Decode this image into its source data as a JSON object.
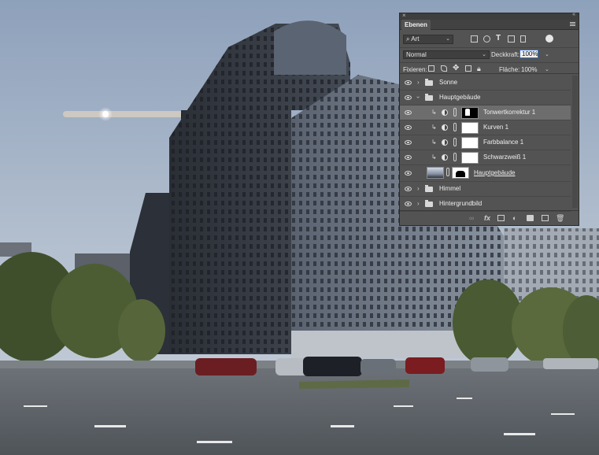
{
  "panel": {
    "tab_label": "Ebenen",
    "filter": {
      "kind": "Art"
    },
    "blend_mode": "Normal",
    "opacity_label": "Deckkraft:",
    "opacity_value": "100%",
    "lock_label": "Fixieren:",
    "fill_label": "Fläche:",
    "fill_value": "100%",
    "layers": [
      {
        "name": "Sonne",
        "type": "group",
        "expanded": false
      },
      {
        "name": "Hauptgebäude",
        "type": "group",
        "expanded": true
      },
      {
        "name": "Tonwertkorrektur 1",
        "type": "adjustment",
        "selected": true,
        "mask": "black"
      },
      {
        "name": "Kurven 1",
        "type": "adjustment",
        "mask": "white"
      },
      {
        "name": "Farbbalance 1",
        "type": "adjustment",
        "mask": "white"
      },
      {
        "name": "Schwarzweiß 1",
        "type": "adjustment",
        "mask": "white"
      },
      {
        "name": "Hauptgebäude",
        "type": "smart-layer"
      },
      {
        "name": "Himmel",
        "type": "group",
        "expanded": false
      },
      {
        "name": "Hintergrundbild",
        "type": "group",
        "expanded": false
      }
    ],
    "bottom_icons": [
      "link-icon",
      "fx-icon",
      "mask-icon",
      "adjustment-icon",
      "folder-icon",
      "new-layer-icon",
      "trash-icon"
    ],
    "bottom_fx": "fx"
  },
  "colors": {
    "panel_bg": "#535353",
    "selected_row": "#6d6d6d",
    "sky_top": "#8fa2bd",
    "sky_bottom": "#c9d2dc"
  }
}
